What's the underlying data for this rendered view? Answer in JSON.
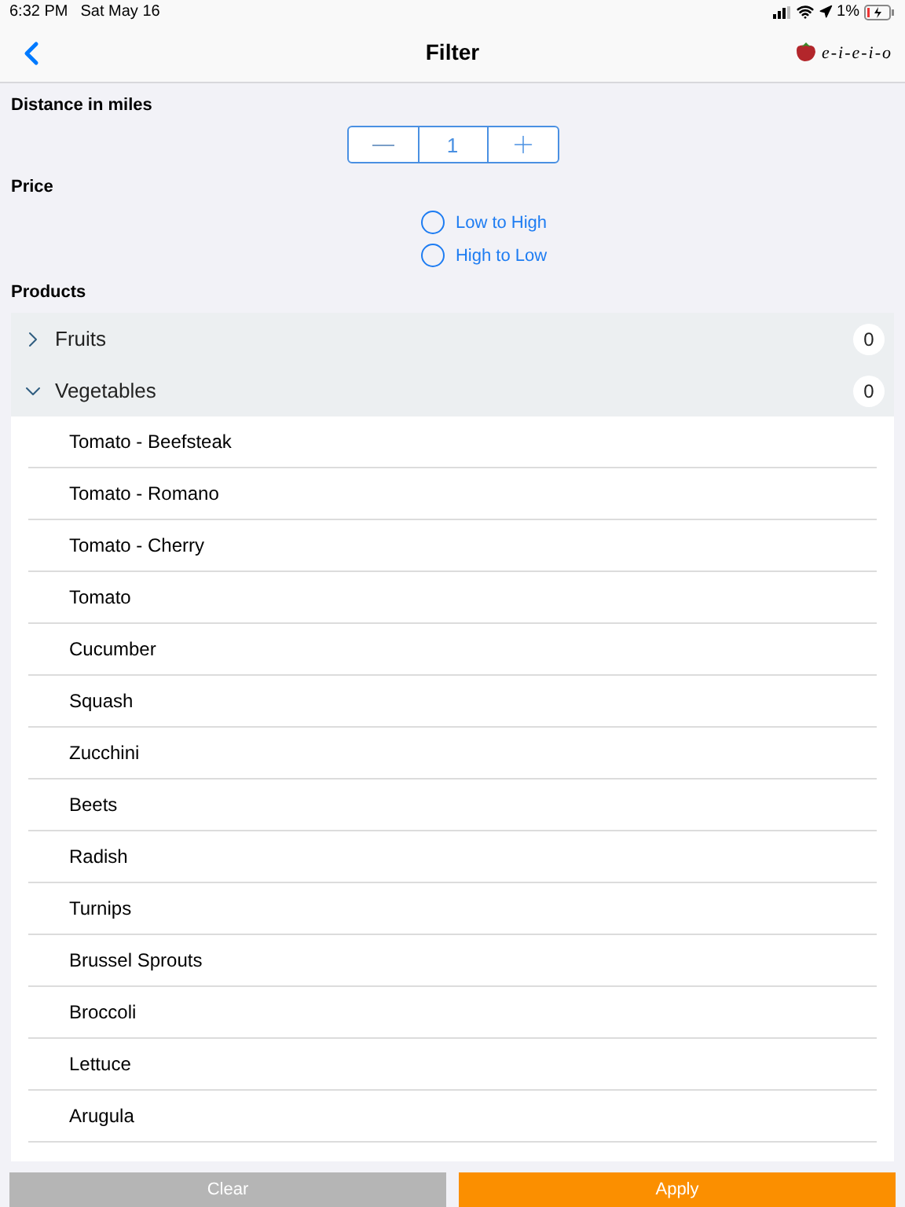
{
  "status_bar": {
    "time": "6:32 PM",
    "date": "Sat May 16",
    "battery": "1%"
  },
  "nav": {
    "title": "Filter",
    "logo_text": "e-i-e-i-o"
  },
  "distance": {
    "label": "Distance in miles",
    "value": "1"
  },
  "price": {
    "label": "Price",
    "options": [
      {
        "label": "Low to High",
        "selected": false
      },
      {
        "label": "High to Low",
        "selected": false
      }
    ]
  },
  "products": {
    "label": "Products",
    "groups": [
      {
        "name": "Fruits",
        "count": "0",
        "expanded": false
      },
      {
        "name": "Vegetables",
        "count": "0",
        "expanded": true,
        "items": [
          "Tomato - Beefsteak",
          "Tomato - Romano",
          "Tomato - Cherry",
          "Tomato",
          "Cucumber",
          "Squash",
          "Zucchini",
          "Beets",
          "Radish",
          "Turnips",
          "Brussel Sprouts",
          "Broccoli",
          "Lettuce",
          "Arugula"
        ]
      }
    ]
  },
  "buttons": [
    {
      "label": "Clear",
      "disabled": true
    },
    {
      "label": "Apply",
      "disabled": false
    }
  ]
}
